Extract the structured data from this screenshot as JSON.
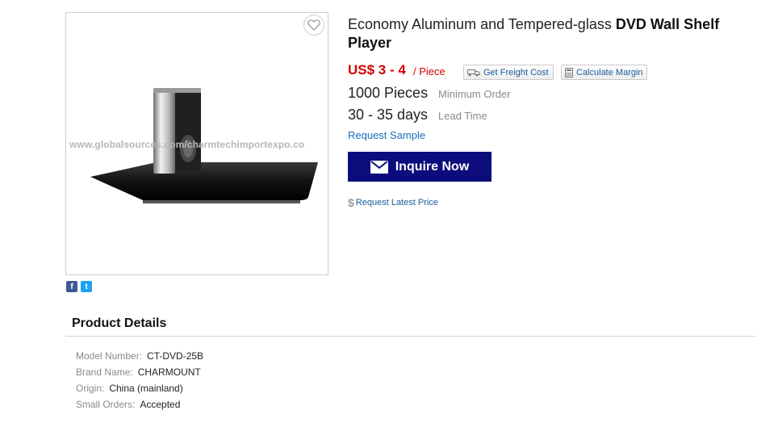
{
  "product": {
    "title_regular": "Economy Aluminum and Tempered-glass ",
    "title_bold": "DVD Wall Shelf Player",
    "price": "US$ 3 - 4",
    "price_unit": "/ Piece",
    "moq_value": "1000 Pieces",
    "moq_label": "Minimum Order",
    "lead_value": "30 - 35 days",
    "lead_label": "Lead Time",
    "request_sample": "Request Sample",
    "inquire_label": "Inquire Now",
    "latest_price_label": "Request Latest Price",
    "watermark": "www.globalsources.com/charmtechimportexpo.co"
  },
  "tools": {
    "freight_label": "Get Freight Cost",
    "margin_label": "Calculate Margin"
  },
  "social": {
    "facebook_glyph": "f",
    "twitter_glyph": "t"
  },
  "details": {
    "heading": "Product Details",
    "rows": [
      {
        "key": "Model Number:",
        "value": "CT-DVD-25B"
      },
      {
        "key": "Brand Name:",
        "value": "CHARMOUNT"
      },
      {
        "key": "Origin:",
        "value": "China (mainland)"
      },
      {
        "key": "Small Orders:",
        "value": "Accepted"
      }
    ]
  },
  "icons": {
    "wishlist": "heart-icon",
    "freight": "truck-icon",
    "margin": "calculator-icon",
    "inquire": "envelope-icon",
    "latest_price": "dollar-icon"
  },
  "colors": {
    "price": "#d40000",
    "link": "#1a6fc0",
    "inquire_bg": "#0c0c7d",
    "facebook": "#3b5998",
    "twitter": "#1da1f2"
  }
}
